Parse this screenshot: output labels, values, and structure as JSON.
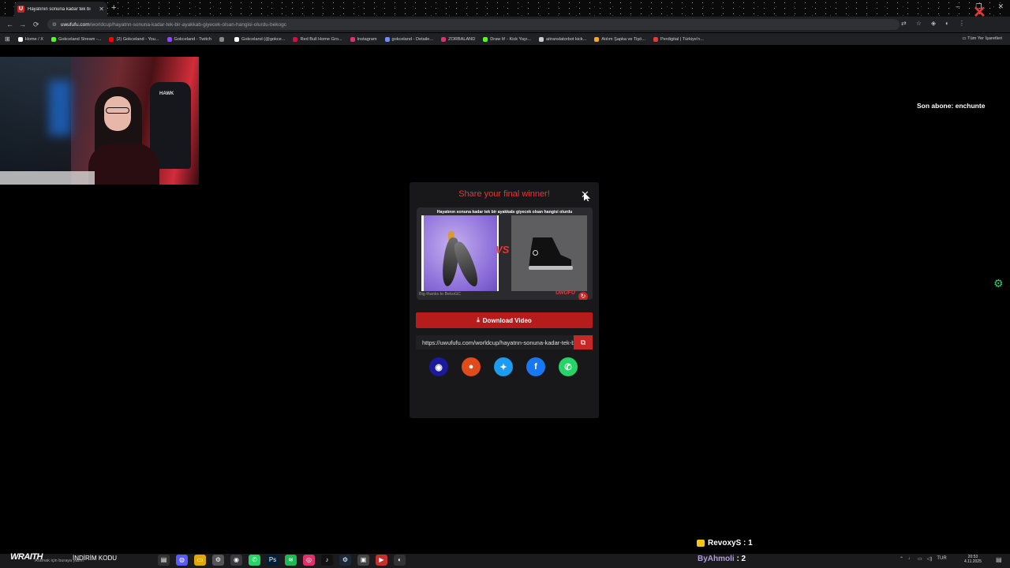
{
  "browser": {
    "tab_title": "Hayatının sonuna kadar tek bi",
    "tab_favicon": "U",
    "new_tab": "+",
    "window_controls": [
      "–",
      "❐",
      "✕"
    ],
    "url_domain": "uwufufu.com",
    "url_path": "/worldcup/hayatnn-sonuna-kadar-tek-bir-ayakkab-giyecek-olsan-hangisi-olurdu-bekogc",
    "nav": [
      "←",
      "→",
      "⟳"
    ],
    "toolbar_icons": [
      "translate-icon",
      "star-icon",
      "extensions-icon",
      "profile-icon",
      "menu-icon"
    ],
    "bookmarks": [
      {
        "label": "Home / X",
        "color": "#ffffff"
      },
      {
        "label": "Gokceland Stream -...",
        "color": "#53fc18"
      },
      {
        "label": "(2) Gokceland - You...",
        "color": "#ff0000"
      },
      {
        "label": "Gokceland - Twitch",
        "color": "#9146ff"
      },
      {
        "label": "",
        "color": "#888888"
      },
      {
        "label": "Gokceland (@gokce...",
        "color": "#ffffff"
      },
      {
        "label": "Red Bull Home Gro...",
        "color": "#db0a40"
      },
      {
        "label": "Instagram",
        "color": "#e1306c"
      },
      {
        "label": "gokceland - Detaile...",
        "color": "#6c8cff"
      },
      {
        "label": "ZORBALAND",
        "color": "#e1306c"
      },
      {
        "label": "Draw It! - Kick Yayı...",
        "color": "#53fc18"
      },
      {
        "label": "aitranslatorbot kick...",
        "color": "#cccccc"
      },
      {
        "label": "Atılım Şapka ve Tişö...",
        "color": "#f5a623"
      },
      {
        "label": "Perdigital | Türkiye'n...",
        "color": "#e53935"
      }
    ],
    "all_bookmarks": "Tüm Yer İşaretleri",
    "brand_logo": "perdigital"
  },
  "stream": {
    "latest_sub": "Son abone: enchunte",
    "chair_brand": "HAWK"
  },
  "modal": {
    "title": "Share your final winner!",
    "close": "✕",
    "preview_title": "Hayatının sonuna kadar tek bir ayakkabı giyecek olsan hangisi olurdu",
    "vs": "VS",
    "thanks": "Big thanks to BekoGC",
    "brand": "UwUFU",
    "download_label": "Download Video",
    "share_url": "https://uwufufu.com/worldcup/hayatnn-sonuna-kadar-tek-bir-ayakkab-giyecek-olsan-hangisi-olurdu-bekogc",
    "share_buttons": [
      {
        "name": "discord",
        "glyph": "◉",
        "color": "#1a1a9a"
      },
      {
        "name": "reddit",
        "glyph": "●",
        "color": "#e14b1c"
      },
      {
        "name": "twitter",
        "glyph": "✦",
        "color": "#1d9bf0"
      },
      {
        "name": "facebook",
        "glyph": "f",
        "color": "#1877f2"
      },
      {
        "name": "whatsapp",
        "glyph": "✆",
        "color": "#25d366"
      }
    ]
  },
  "overlay": {
    "counter1": "RevoxyS : 1",
    "counter2_user": "ByAhmoli",
    "counter2_value": " : 2"
  },
  "taskbar": {
    "brand": "WRAITH",
    "promo": "İNDİRİM KODU",
    "search": "Aramak için buraya yazın",
    "tray_lang": "TUR",
    "time": "20:53",
    "date": "4.11.2025"
  }
}
